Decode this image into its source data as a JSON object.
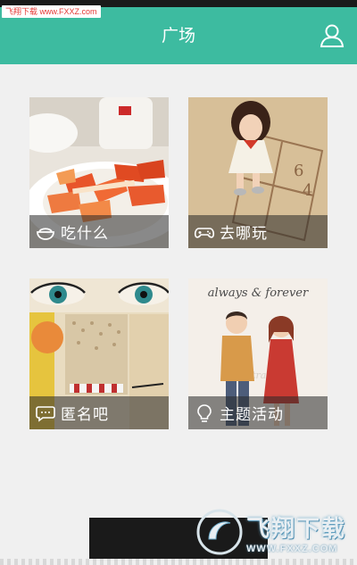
{
  "watermark": {
    "top_left": "飞翔下载 www.FXXZ.com",
    "brand": "飞翔下载",
    "url": "WWW.FXXZ.COM"
  },
  "header": {
    "title": "广场"
  },
  "tiles": [
    {
      "label": "吃什么",
      "icon": "bowl-icon"
    },
    {
      "label": "去哪玩",
      "icon": "gamepad-icon"
    },
    {
      "label": "匿名吧",
      "icon": "chat-bubble-icon"
    },
    {
      "label": "主题活动",
      "icon": "lightbulb-icon"
    }
  ],
  "art_text": {
    "forever": "always & forever",
    "illustration": "Illustration"
  },
  "colors": {
    "header": "#3dbba0",
    "background": "#f0f0f0",
    "caption_overlay": "rgba(40,40,40,0.55)"
  }
}
